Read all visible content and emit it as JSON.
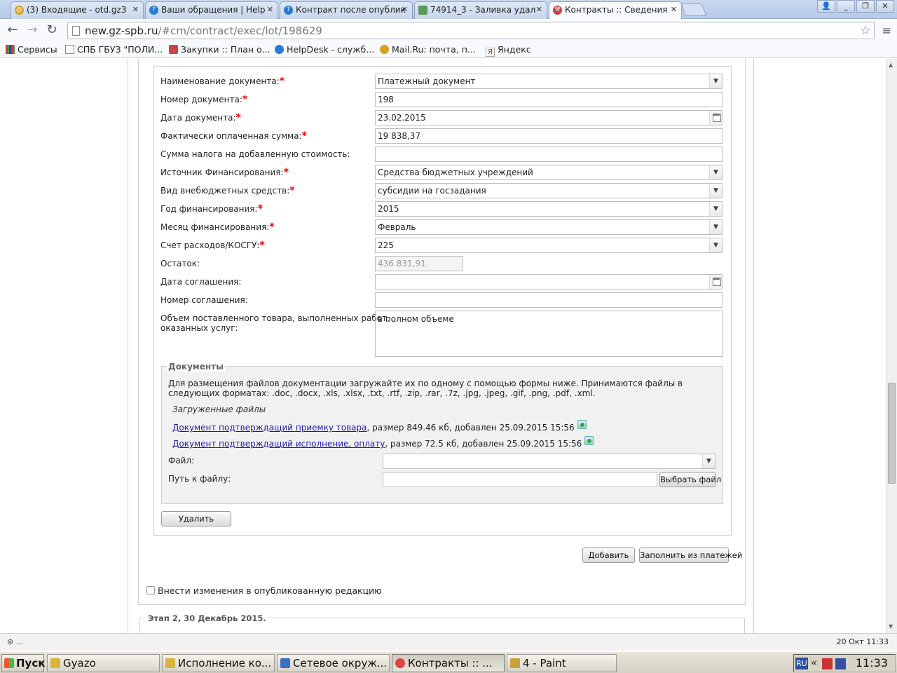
{
  "browser": {
    "tabs": [
      {
        "title": "(3) Входящие - otd.gz3",
        "icon_color": "#d9a21a",
        "active": false
      },
      {
        "title": "Ваши обращения | Help",
        "icon_color": "#2a7bd4",
        "active": false
      },
      {
        "title": "Контракт после опублик",
        "icon_color": "#2a7bd4",
        "active": false
      },
      {
        "title": "74914_3 - Заливка удал",
        "icon_color": "#5a9a5a",
        "active": false
      },
      {
        "title": "Контракты :: Сведения",
        "icon_color": "#c44",
        "active": true
      }
    ],
    "url_domain": "new.gz-spb.ru",
    "url_path": "/#cm/contract/exec/lot/198629",
    "bookmarks": [
      "Сервисы",
      "СПБ ГБУЗ \"ПОЛИ...",
      "Закупки :: План о...",
      "HelpDesk - служб...",
      "Mail.Ru: почта, п...",
      "Яндекс"
    ]
  },
  "form": {
    "fields": [
      {
        "label": "Наименование документа:",
        "required": true,
        "type": "select",
        "value": "Платежный документ"
      },
      {
        "label": "Номер документа:",
        "required": true,
        "type": "text",
        "value": "198"
      },
      {
        "label": "Дата документа:",
        "required": true,
        "type": "date",
        "value": "23.02.2015"
      },
      {
        "label": "Фактически оплаченная сумма:",
        "required": true,
        "type": "text",
        "value": "19 838,37"
      },
      {
        "label": "Сумма налога на добавленную стоимость:",
        "required": false,
        "type": "text",
        "value": ""
      },
      {
        "label": "Источник Финансирования:",
        "required": true,
        "type": "select",
        "value": "Средства бюджетных учреждений"
      },
      {
        "label": "Вид внебюджетных средств:",
        "required": true,
        "type": "select",
        "value": "субсидии на госзадания"
      },
      {
        "label": "Год финансирования:",
        "required": true,
        "type": "select",
        "value": "2015"
      },
      {
        "label": "Месяц финансирования:",
        "required": true,
        "type": "select",
        "value": "Февраль"
      },
      {
        "label": "Счет расходов/КОСГУ:",
        "required": true,
        "type": "select",
        "value": "225"
      },
      {
        "label": "Остаток:",
        "required": false,
        "type": "disabled",
        "value": "436 831,91"
      },
      {
        "label": "Дата соглашения:",
        "required": false,
        "type": "date",
        "value": ""
      },
      {
        "label": "Номер соглашения:",
        "required": false,
        "type": "text",
        "value": ""
      }
    ],
    "volume_label_1": "Объем поставленного товара, выполненных работ,",
    "volume_label_2": "оказанных услуг:",
    "volume_value": "в полном объеме"
  },
  "documents": {
    "legend": "Документы",
    "instructions": "Для размещения файлов документации загружайте их по одному с помощью формы ниже. Принимаются файлы в следующих форматах: .doc, .docx, .xls, .xlsx, .txt, .rtf, .zip, .rar, .7z, .jpg, .jpeg, .gif, .png, .pdf, .xml.",
    "uploaded_title": "Загруженные файлы",
    "files": [
      {
        "name": "Документ подтверждащий приемку товара",
        "info": ", размер 849.46 кб, добавлен 25.09.2015 15:56"
      },
      {
        "name": "Документ подтверждащий исполнение, оплату",
        "info": ", размер 72.5 кб, добавлен 25.09.2015 15:56"
      }
    ],
    "file_label": "Файл:",
    "path_label": "Путь к файлу:",
    "choose_file": "Выбрать файл",
    "delete": "Удалить"
  },
  "actions": {
    "add": "Добавить",
    "fill_from_payments": "Заполнить из платежей",
    "publish_changes": "Внести изменения в опубликованную редакцию"
  },
  "stage": {
    "legend": "Этап 2, 30 Декабрь 2015."
  },
  "statusbar": {
    "left": "...",
    "right": "20 Окт 11:33"
  },
  "taskbar": {
    "start": "Пуск",
    "tasks": [
      {
        "label": "Gyazo",
        "icon_color": "#d9b33a",
        "active": false
      },
      {
        "label": "Исполнение ко...",
        "icon_color": "#d9b33a",
        "active": false
      },
      {
        "label": "Сетевое окруж...",
        "icon_color": "#3a6fc2",
        "active": false
      },
      {
        "label": "Контракты :: ...",
        "icon_color": "#d44",
        "active": true
      },
      {
        "label": "4 - Paint",
        "icon_color": "#c9a03a",
        "active": false
      }
    ],
    "lang": "RU",
    "clock": "11:33"
  }
}
